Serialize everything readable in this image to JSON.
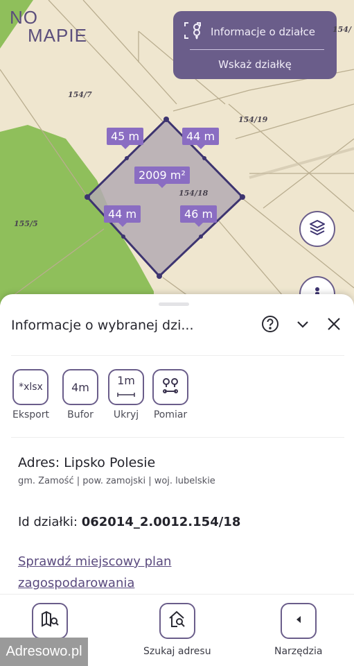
{
  "brand": {
    "line1": "NO",
    "line2": "MAPIE"
  },
  "info_card": {
    "title": "Informacje o działce",
    "action": "Wskaż działkę"
  },
  "map": {
    "plot_numbers": [
      "154/7",
      "154/19",
      "154/18",
      "155/5",
      "154/"
    ],
    "edge_labels": [
      "45 m",
      "44 m",
      "44 m",
      "46 m"
    ],
    "area_label": "2009 m²",
    "colors": {
      "parcel_fill": "#b4aab3",
      "parcel_border": "#3d3470",
      "label_bg": "#8a6dc2",
      "forest": "#8fbf5b"
    }
  },
  "sheet": {
    "title": "Informacje o wybranej dzi...",
    "tools": [
      {
        "label": "*xlsx",
        "caption": "Eksport"
      },
      {
        "label": "4m",
        "caption": "Bufor"
      },
      {
        "label": "1m",
        "caption": "Ukryj"
      },
      {
        "label": "",
        "caption": "Pomiar"
      }
    ],
    "address": "Adres: Lipsko Polesie",
    "address_sub": "gm. Zamość | pow. zamojski | woj. lubelskie",
    "id_label": "Id działki:",
    "id_value": "062014_2.0012.154/18",
    "plan_link": "Sprawdź miejscowy plan zagospodarowania"
  },
  "bottom_nav": [
    {
      "caption": ""
    },
    {
      "caption": "Szukaj adresu"
    },
    {
      "caption": "Narzędzia"
    }
  ],
  "watermark": "Adresowo.pl",
  "accent": "#6a5d8a"
}
